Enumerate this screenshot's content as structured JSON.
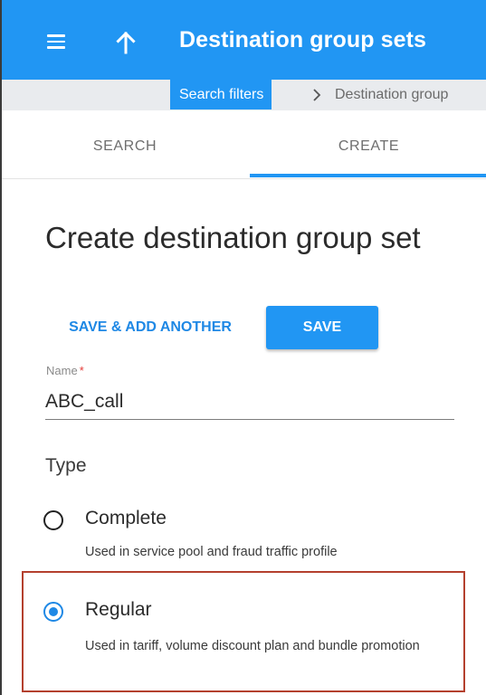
{
  "appbar": {
    "title": "Destination group sets",
    "menu_icon": "hamburger-menu-icon",
    "up_icon": "arrow-up-icon",
    "color": "#2196f3"
  },
  "breadcrumb": {
    "chip": "Search filters",
    "separator_icon": "chevron-right-icon",
    "current": "Destination group"
  },
  "tabs": [
    {
      "label": "SEARCH",
      "active": false
    },
    {
      "label": "CREATE",
      "active": true
    }
  ],
  "form": {
    "title": "Create destination group set",
    "save_add_label": "SAVE & ADD ANOTHER",
    "save_label": "SAVE",
    "name_label": "Name",
    "required_mark": "*",
    "name_value": "ABC_call",
    "type_label": "Type",
    "options": [
      {
        "label": "Complete",
        "description": "Used in service pool and fraud traffic profile",
        "selected": false
      },
      {
        "label": "Regular",
        "description": "Used in tariff, volume discount plan and bundle promotion",
        "selected": true
      }
    ]
  },
  "colors": {
    "accent": "#2196f3",
    "highlight_border": "#b4402e",
    "required": "#e53935"
  }
}
